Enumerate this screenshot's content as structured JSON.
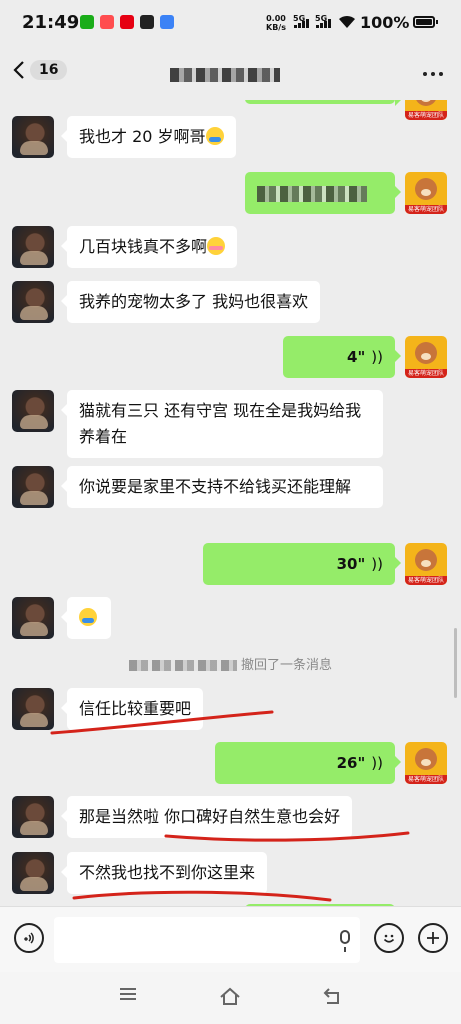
{
  "status_bar": {
    "time": "21:49",
    "net_speed": "0.00",
    "net_unit": "KB/s",
    "sim1": "5G",
    "sim2": "5G",
    "battery": "100%",
    "app_icon_colors": [
      "#1aad19",
      "#ff4d4f",
      "#e60012",
      "#222222",
      "#3b82f6"
    ]
  },
  "header": {
    "back_count": "16",
    "more_icon": "more-dots-icon"
  },
  "messages": [
    {
      "side": "left",
      "text": "我也才 20 岁啊哥",
      "emoji": "cry"
    },
    {
      "side": "right",
      "text": "",
      "redacted": true
    },
    {
      "side": "left",
      "text": "几百块钱真不多啊",
      "emoji": "blush"
    },
    {
      "side": "left",
      "text": "我养的宠物太多了 我妈也很喜欢"
    },
    {
      "side": "right",
      "voice": "4\""
    },
    {
      "side": "left",
      "text": "猫就有三只 还有守宫 现在全是我妈给我养着在"
    },
    {
      "side": "left",
      "text": "你说要是家里不支持不给钱买还能理解"
    },
    {
      "side": "right",
      "voice": "30\""
    },
    {
      "side": "left",
      "text": "",
      "emoji": "cry"
    },
    {
      "side": "system",
      "text": "撤回了一条消息"
    },
    {
      "side": "left",
      "text": "信任比较重要吧"
    },
    {
      "side": "right",
      "voice": "26\""
    },
    {
      "side": "left",
      "text": "那是当然啦 你口碑好自然生意也会好"
    },
    {
      "side": "left",
      "text": "不然我也找不到你这里来"
    }
  ],
  "brand_avatar_caption": "易客萌宠团队",
  "annotation_color": "#d4231a",
  "bubble_color_self": "#95ec69"
}
